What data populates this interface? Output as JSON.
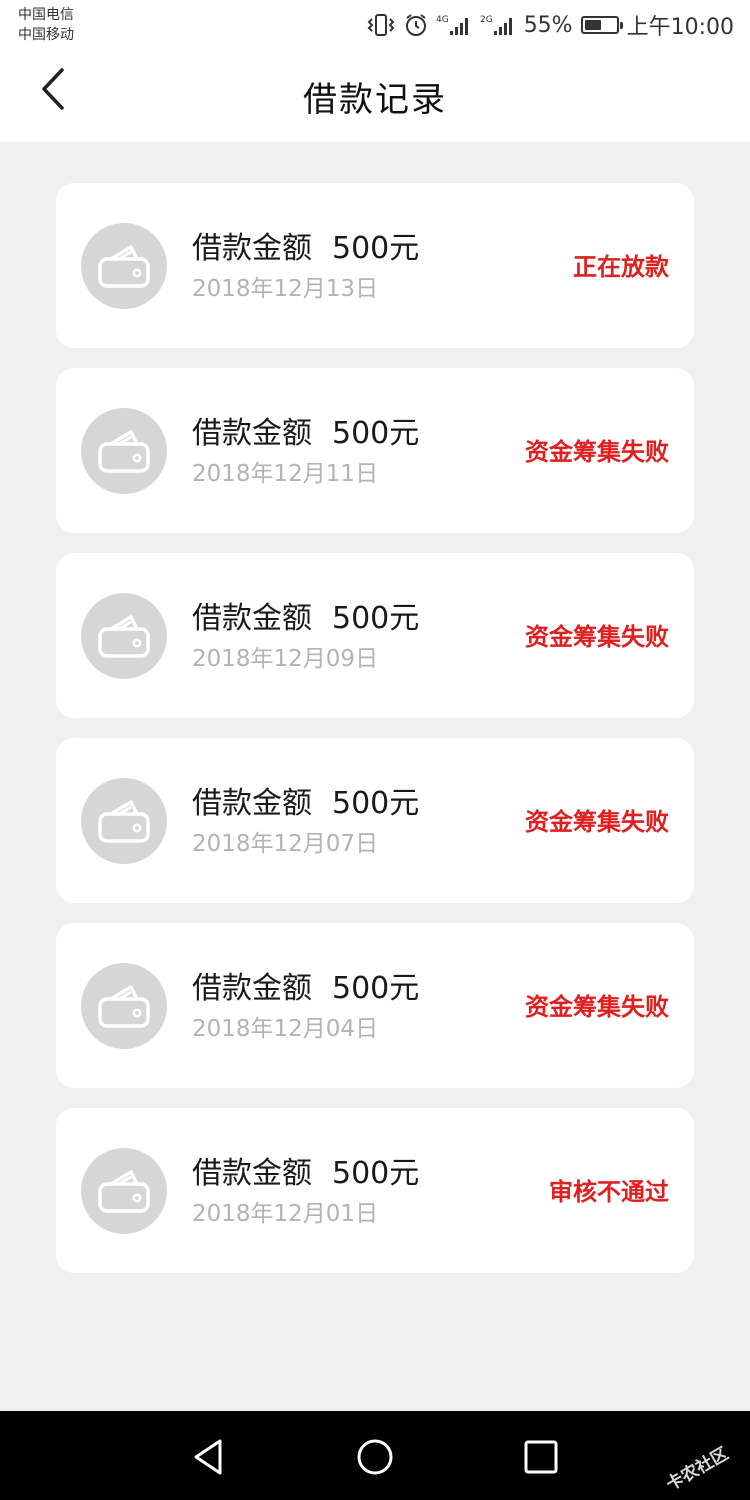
{
  "status_bar": {
    "carrier1": "中国电信",
    "carrier2": "中国移动",
    "signal1_label": "4G",
    "signal2_label": "2G",
    "battery_percent": "55%",
    "battery_level": 0.55,
    "time": "上午10:00"
  },
  "header": {
    "title": "借款记录",
    "back_icon": "chevron-left-icon"
  },
  "records": [
    {
      "label": "借款金额",
      "amount": "500元",
      "date": "2018年12月13日",
      "status": "正在放款"
    },
    {
      "label": "借款金额",
      "amount": "500元",
      "date": "2018年12月11日",
      "status": "资金筹集失败"
    },
    {
      "label": "借款金额",
      "amount": "500元",
      "date": "2018年12月09日",
      "status": "资金筹集失败"
    },
    {
      "label": "借款金额",
      "amount": "500元",
      "date": "2018年12月07日",
      "status": "资金筹集失败"
    },
    {
      "label": "借款金额",
      "amount": "500元",
      "date": "2018年12月04日",
      "status": "资金筹集失败"
    },
    {
      "label": "借款金额",
      "amount": "500元",
      "date": "2018年12月01日",
      "status": "审核不通过"
    }
  ],
  "nav_bar": {
    "back_icon": "triangle-back-icon",
    "home_icon": "circle-home-icon",
    "recents_icon": "square-recents-icon"
  },
  "watermark": {
    "text": "卡农社区"
  },
  "colors": {
    "status_red": "#e02020",
    "date_gray": "#b3b3b3",
    "icon_bg": "#d6d6d6",
    "page_bg": "#f0f0f0"
  }
}
